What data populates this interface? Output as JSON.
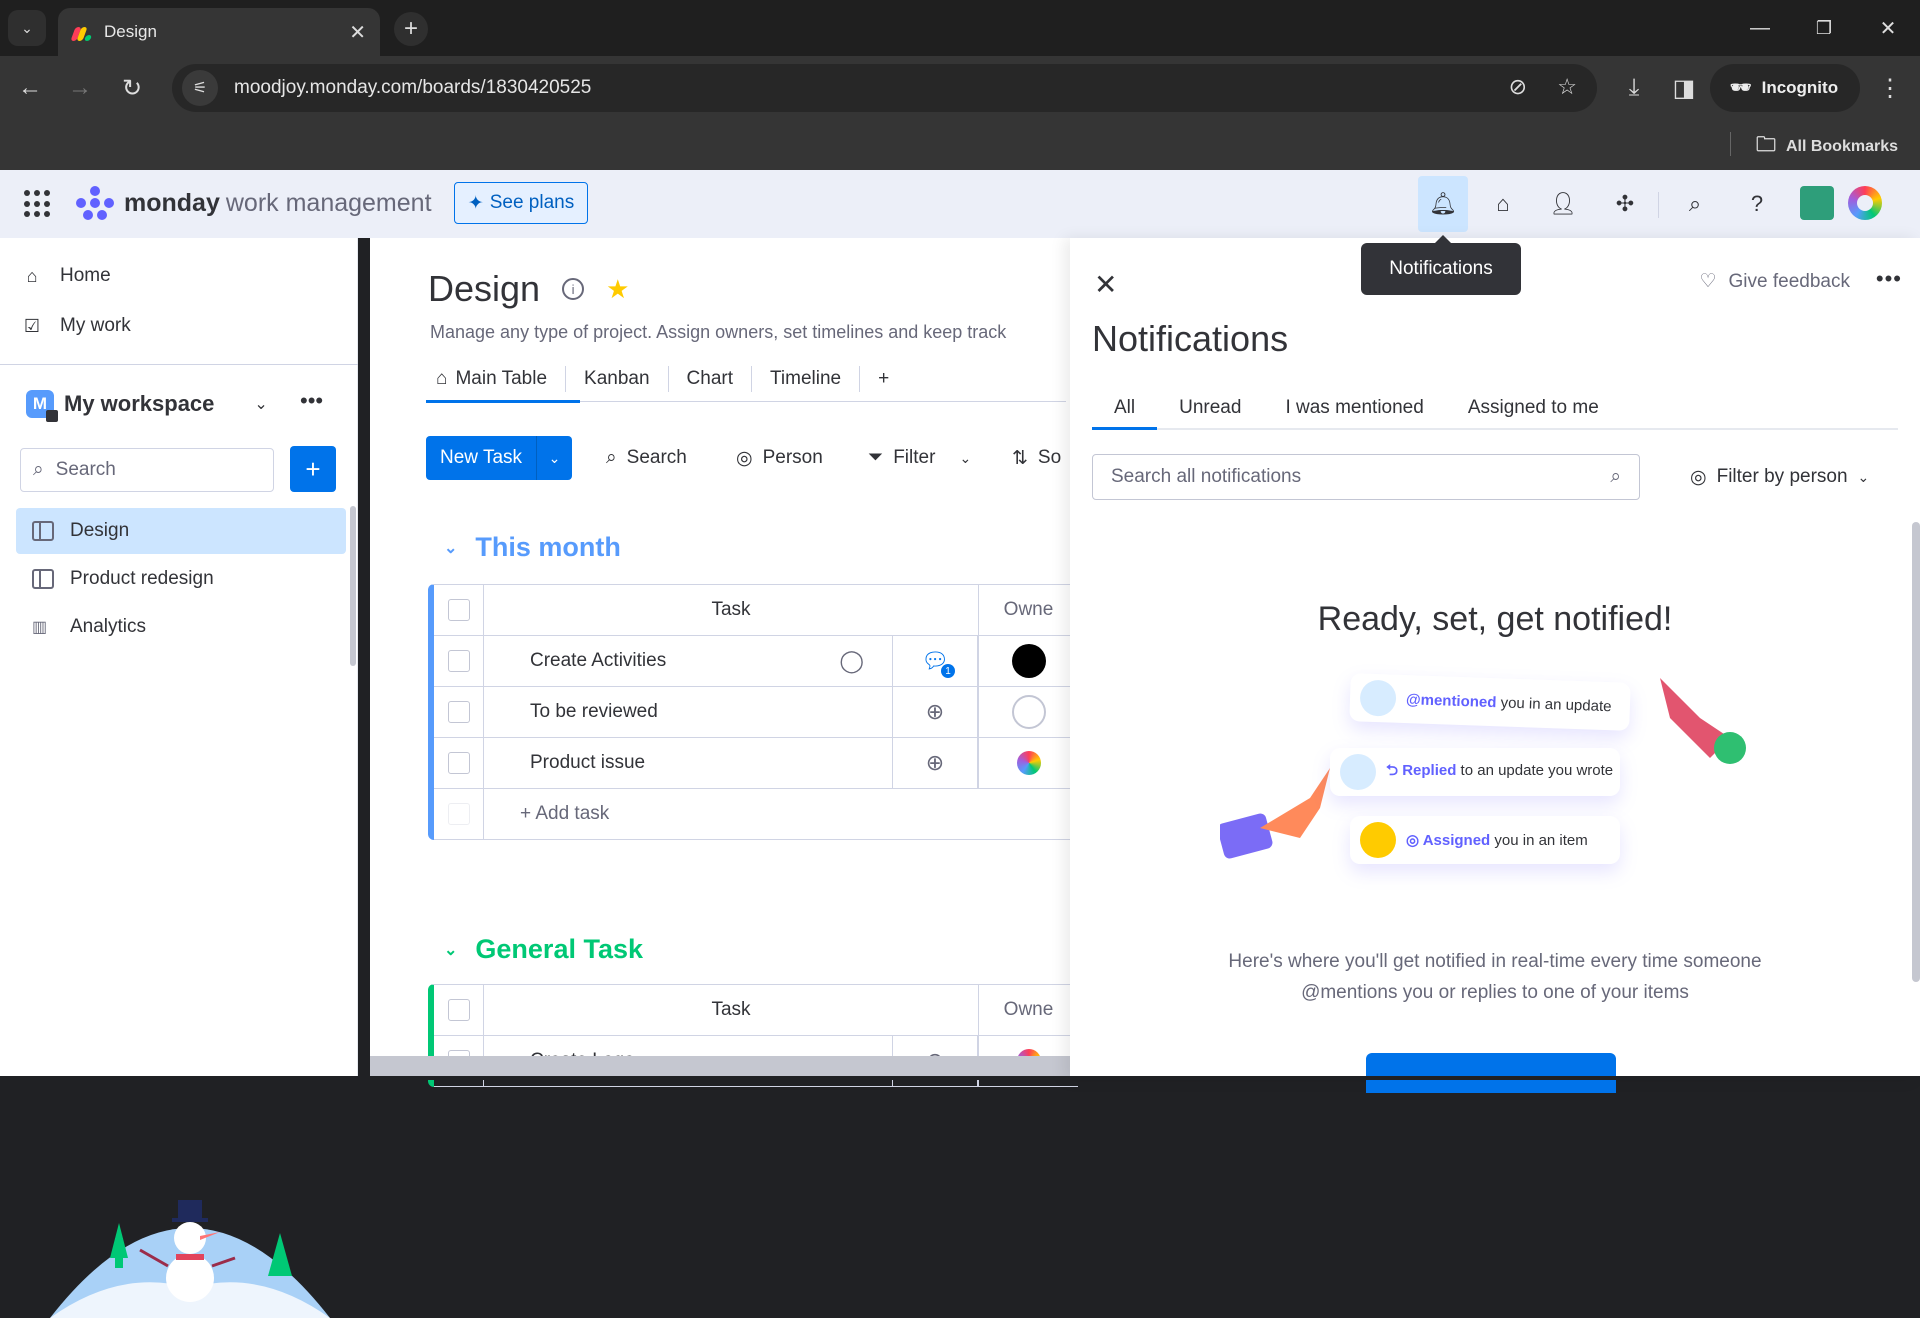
{
  "browser": {
    "tab_title": "Design",
    "url": "moodjoy.monday.com/boards/1830420525",
    "incognito_label": "Incognito",
    "bookmarks_label": "All Bookmarks",
    "icons": {
      "tab_list": "chevron-down-icon",
      "close_tab": "close-icon",
      "new_tab": "plus-icon",
      "back": "arrow-left-icon",
      "forward": "arrow-right-icon",
      "reload": "reload-icon",
      "site_info": "tune-icon",
      "eye_off": "eye-off-icon",
      "bookmark": "star-icon",
      "download": "download-icon",
      "sidepanel": "side-panel-icon",
      "menu": "kebab-icon"
    }
  },
  "app_header": {
    "brand_bold": "monday",
    "brand_light": "work management",
    "see_plans": "See plans",
    "tooltip": "Notifications",
    "icons": [
      "bell-icon",
      "inbox-icon",
      "invite-user-icon",
      "puzzle-icon",
      "search-icon",
      "help-icon",
      "avatar",
      "workspace-logo"
    ]
  },
  "sidebar": {
    "nav": [
      {
        "label": "Home",
        "icon": "home-icon"
      },
      {
        "label": "My work",
        "icon": "calendar-check-icon"
      }
    ],
    "workspace": {
      "initial": "M",
      "name": "My workspace"
    },
    "search_placeholder": "Search",
    "boards": [
      {
        "label": "Design",
        "active": true,
        "icon": "board-icon"
      },
      {
        "label": "Product redesign",
        "active": false,
        "icon": "board-icon"
      },
      {
        "label": "Analytics",
        "active": false,
        "icon": "dashboard-icon"
      }
    ]
  },
  "board": {
    "title": "Design",
    "description": "Manage any type of project. Assign owners, set timelines and keep track",
    "views": [
      "Main Table",
      "Kanban",
      "Chart",
      "Timeline",
      "+"
    ],
    "active_view": "Main Table",
    "toolbar": {
      "new_task": "New Task",
      "search": "Search",
      "person": "Person",
      "filter": "Filter",
      "sort": "So"
    },
    "groups": [
      {
        "title": "This month",
        "color": "#579bfc",
        "columns": {
          "task": "Task",
          "owner": "Owne"
        },
        "rows": [
          {
            "task": "Create Activities",
            "update_count": "1",
            "owner": "filled-user"
          },
          {
            "task": "To be reviewed",
            "update_count": "",
            "owner": "empty-user"
          },
          {
            "task": "Product issue",
            "update_count": "",
            "owner": "workspace-logo"
          }
        ],
        "add_label": "+ Add task"
      },
      {
        "title": "General Task",
        "color": "#00c875",
        "columns": {
          "task": "Task",
          "owner": "Owne"
        },
        "rows": [
          {
            "task": "Create Logo",
            "update_count": "",
            "owner": "workspace-logo"
          }
        ]
      }
    ]
  },
  "notifications": {
    "title": "Notifications",
    "feedback": "Give feedback",
    "tabs": [
      "All",
      "Unread",
      "I was mentioned",
      "Assigned to me"
    ],
    "active_tab": "All",
    "search_placeholder": "Search all notifications",
    "filter_label": "Filter by person",
    "empty_heading": "Ready, set, get notified!",
    "cards": [
      {
        "highlight": "@mentioned",
        "text": "you in an update"
      },
      {
        "highlight": "Replied",
        "text": "to an update you wrote"
      },
      {
        "highlight": "Assigned",
        "text": "you in an item"
      }
    ],
    "empty_desc_1": "Here's where you'll get notified in real-time every time someone",
    "empty_desc_2": "@mentions you or replies to one of your items"
  },
  "colors": {
    "primary": "#0073ea",
    "brand_purple": "#6161ff",
    "group_blue": "#579bfc",
    "group_green": "#00c875",
    "star": "#ffcb00"
  }
}
